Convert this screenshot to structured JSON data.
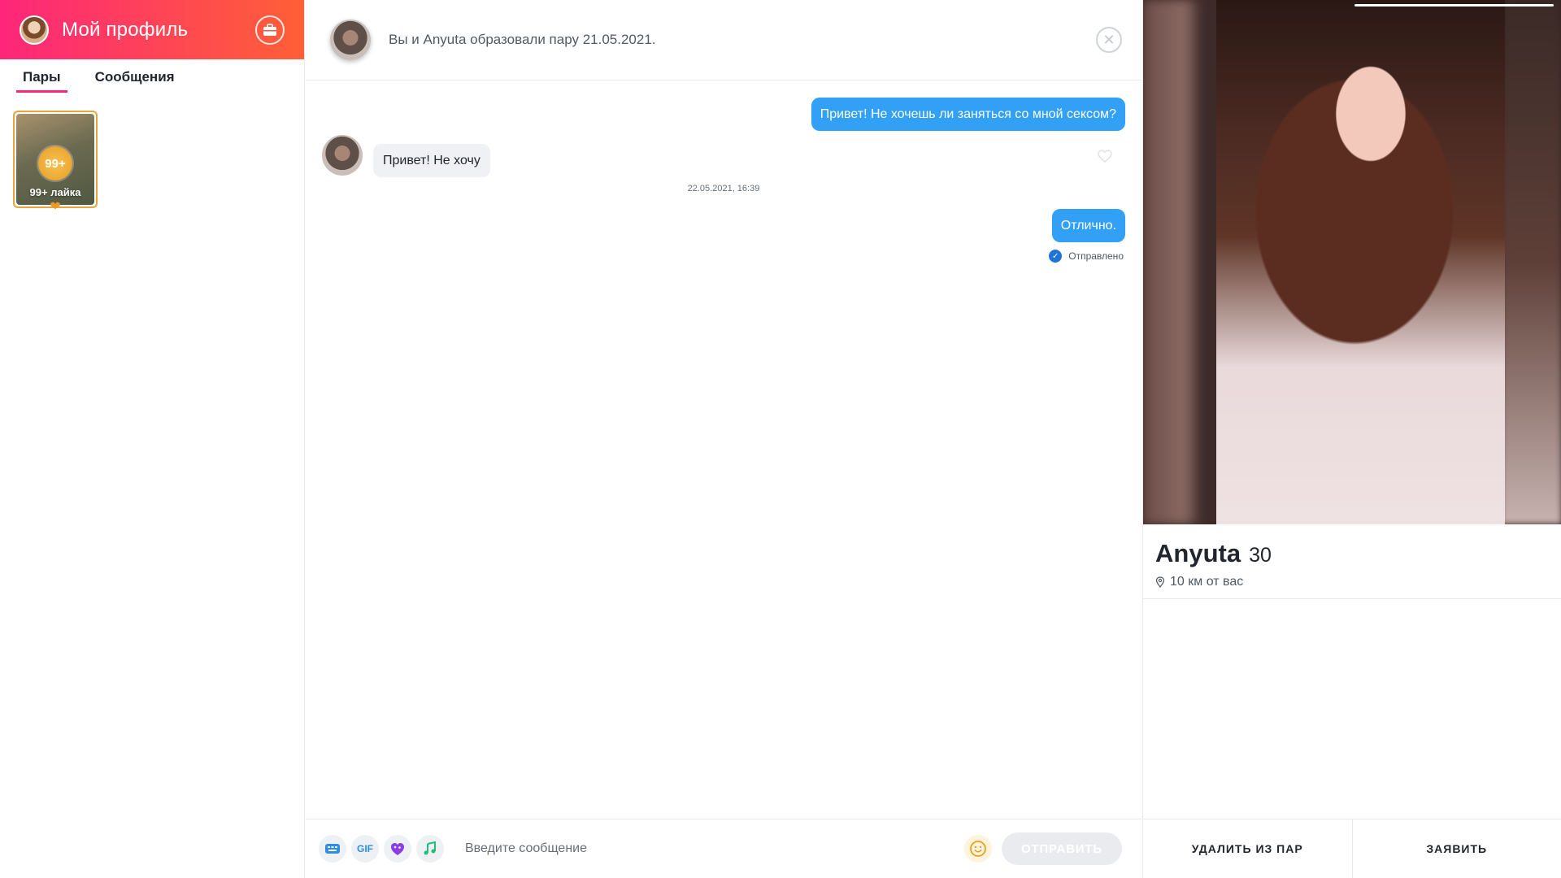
{
  "sidebar": {
    "title": "Мой профиль",
    "tabs": [
      "Пары",
      "Сообщения"
    ],
    "likes_tile": {
      "count": "99+",
      "label": "99+ лайка"
    }
  },
  "chat": {
    "header_text": "Вы и Anyuta образовали пару 21.05.2021.",
    "messages": [
      {
        "direction": "out",
        "text": "Привет! Не хочешь ли заняться со мной сексом?"
      },
      {
        "direction": "in",
        "text": "Привет! Не хочу"
      },
      {
        "direction": "out",
        "text": "Отлично."
      }
    ],
    "timestamp": "22.05.2021, 16:39",
    "status": "Отправлено",
    "composer": {
      "placeholder": "Введите сообщение",
      "gif_label": "GIF",
      "send_label": "ОТПРАВИТЬ"
    }
  },
  "profile": {
    "name": "Anyuta",
    "age": "30",
    "distance": "10 км от вас",
    "actions": [
      "УДАЛИТЬ ИЗ ПАР",
      "ЗАЯВИТЬ"
    ]
  },
  "colors": {
    "brand_gradient_start": "#fd267a",
    "brand_gradient_end": "#ff6036",
    "outgoing_bubble": "#31a0f5",
    "incoming_bubble": "#eff1f4",
    "likes_gold": "#e7a43b"
  },
  "icons": [
    "briefcase-icon",
    "close-icon",
    "heart-icon",
    "keyboard-icon",
    "gif-icon",
    "sticker-icon",
    "music-icon",
    "emoji-icon",
    "check-icon",
    "location-pin-icon"
  ]
}
